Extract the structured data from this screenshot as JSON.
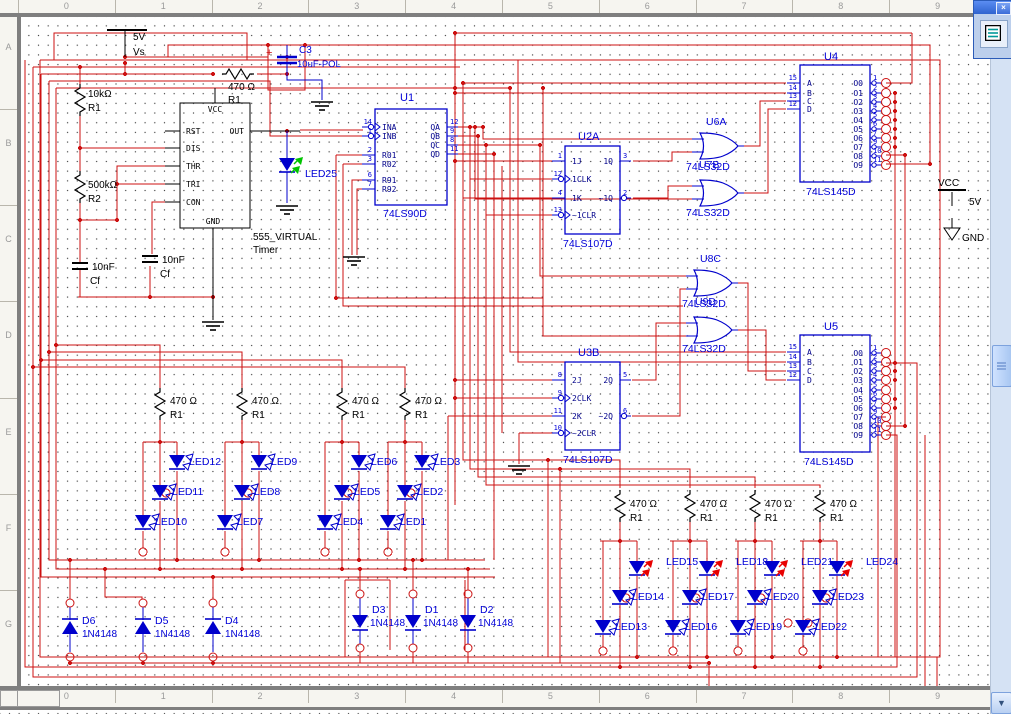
{
  "colors": {
    "wire_red": "#cc1111",
    "component_blue": "#0000cc",
    "label_blue": "#0000d8",
    "text_black": "#000000",
    "arrow_green": "#00c400",
    "arrow_red": "#e80000",
    "grid_dot": "#3f3f3f",
    "ruler_text": "#9a9a9a",
    "frame_gray": "#7f7f7f",
    "titlebar_blue": "#2f63cf",
    "scroll_track": "#d5e2f4"
  },
  "rulers": {
    "top": [
      "0",
      "1",
      "2",
      "3",
      "4",
      "5",
      "6",
      "7",
      "8",
      "9"
    ],
    "bottom": [
      "0",
      "1",
      "2",
      "3",
      "4",
      "5",
      "6",
      "7",
      "8",
      "9"
    ],
    "left": [
      "A",
      "B",
      "C",
      "D",
      "E",
      "F",
      "G"
    ]
  },
  "mini_window": {
    "close_label": "×"
  },
  "scrollbar": {
    "down_arrow": "▼"
  },
  "power": {
    "vcc_label": "VCC",
    "vcc_value": "5V",
    "gnd_label": "GND",
    "source_value": "5V",
    "source_ref": "Vs"
  },
  "timer555": {
    "part_line1": "555_VIRTUAL",
    "part_line2": "Timer",
    "pin_top": "VCC",
    "pin_bottom": "GND",
    "pin_right": "OUT",
    "pins_left": [
      "RST",
      "DIS",
      "THR",
      "TRI",
      "CON"
    ]
  },
  "ics": [
    {
      "ref": "U1",
      "part": "74LS90D",
      "left": [
        [
          "14",
          "INA"
        ],
        [
          "1",
          "INB"
        ],
        [
          "2",
          "R01"
        ],
        [
          "3",
          "R02"
        ],
        [
          "6",
          "R91"
        ],
        [
          "7",
          "R92"
        ]
      ],
      "right": [
        [
          "12",
          "QA"
        ],
        [
          "9",
          "QB"
        ],
        [
          "8",
          "QC"
        ],
        [
          "11",
          "QD"
        ]
      ]
    },
    {
      "ref": "U2A",
      "part": "74LS107D",
      "left": [
        [
          "1",
          "1J"
        ],
        [
          "12",
          "1CLK"
        ],
        [
          "4",
          "1K"
        ],
        [
          "13",
          "~1CLR"
        ]
      ],
      "right": [
        [
          "3",
          "1Q"
        ],
        [
          "2",
          "~1Q"
        ]
      ]
    },
    {
      "ref": "U3B",
      "part": "74LS107D",
      "left": [
        [
          "8",
          "2J"
        ],
        [
          "9",
          "2CLK"
        ],
        [
          "11",
          "2K"
        ],
        [
          "10",
          "~2CLR"
        ]
      ],
      "right": [
        [
          "5",
          "2Q"
        ],
        [
          "6",
          "~2Q"
        ]
      ]
    },
    {
      "ref": "U4",
      "part": "74LS145D",
      "left": [
        [
          "15",
          "A"
        ],
        [
          "14",
          "B"
        ],
        [
          "13",
          "C"
        ],
        [
          "12",
          "D"
        ]
      ],
      "right": [
        [
          "1",
          "O0"
        ],
        [
          "2",
          "O1"
        ],
        [
          "3",
          "O2"
        ],
        [
          "4",
          "O3"
        ],
        [
          "5",
          "O4"
        ],
        [
          "6",
          "O5"
        ],
        [
          "7",
          "O6"
        ],
        [
          "9",
          "O7"
        ],
        [
          "10",
          "O8"
        ],
        [
          "11",
          "O9"
        ]
      ]
    },
    {
      "ref": "U5",
      "part": "74LS145D",
      "left": [
        [
          "15",
          "A"
        ],
        [
          "14",
          "B"
        ],
        [
          "13",
          "C"
        ],
        [
          "12",
          "D"
        ]
      ],
      "right": [
        [
          "1",
          "O0"
        ],
        [
          "2",
          "O1"
        ],
        [
          "3",
          "O2"
        ],
        [
          "4",
          "O3"
        ],
        [
          "5",
          "O4"
        ],
        [
          "6",
          "O5"
        ],
        [
          "7",
          "O6"
        ],
        [
          "9",
          "O7"
        ],
        [
          "10",
          "O8"
        ],
        [
          "11",
          "O9"
        ]
      ]
    }
  ],
  "gates": [
    {
      "ref": "U6A",
      "part": "74LS32D"
    },
    {
      "ref": "U7B",
      "part": "74LS32D"
    },
    {
      "ref": "U8C",
      "part": "74LS32D"
    },
    {
      "ref": "U9D",
      "part": "74LS32D"
    }
  ],
  "resistors": [
    {
      "id": "r10k",
      "value": "10kΩ",
      "ref": "R1"
    },
    {
      "id": "r500k",
      "value": "500kΩ",
      "ref": "R2"
    },
    {
      "id": "r470top",
      "value": "470 Ω",
      "ref": "R1"
    },
    {
      "id": "rl0",
      "value": "470 Ω",
      "ref": "R1"
    },
    {
      "id": "rl1",
      "value": "470 Ω",
      "ref": "R1"
    },
    {
      "id": "rl2",
      "value": "470 Ω",
      "ref": "R1"
    },
    {
      "id": "rl3",
      "value": "470 Ω",
      "ref": "R1"
    },
    {
      "id": "rr0",
      "value": "470 Ω",
      "ref": "R1"
    },
    {
      "id": "rr1",
      "value": "470 Ω",
      "ref": "R1"
    },
    {
      "id": "rr2",
      "value": "470 Ω",
      "ref": "R1"
    },
    {
      "id": "rr3",
      "value": "470 Ω",
      "ref": "R1"
    }
  ],
  "capacitors": [
    {
      "id": "cf1",
      "value": "10nF",
      "ref": "Cf"
    },
    {
      "id": "cf2",
      "value": "10nF",
      "ref": "Cf"
    },
    {
      "id": "c3",
      "ref": "C3",
      "value": "10uF-POL",
      "polarity": "+"
    }
  ],
  "leds": {
    "indicator": {
      "label": "LED25"
    },
    "left_cluster": [
      "LED12",
      "LED11",
      "LED10",
      "LED9",
      "LED8",
      "LED7",
      "LED6",
      "LED5",
      "LED4",
      "LED3",
      "LED2",
      "LED1"
    ],
    "right_top": [
      "LED15",
      "LED18",
      "LED21",
      "LED24"
    ],
    "right_mid": [
      "LED14",
      "LED17",
      "LED20",
      "LED23"
    ],
    "right_bottom": [
      "LED13",
      "LED16",
      "LED19",
      "LED22"
    ]
  },
  "diodes": [
    {
      "ref": "D6",
      "part": "1N4148"
    },
    {
      "ref": "D5",
      "part": "1N4148"
    },
    {
      "ref": "D4",
      "part": "1N4148"
    },
    {
      "ref": "D3",
      "part": "1N4148"
    },
    {
      "ref": "D1",
      "part": "1N4148"
    },
    {
      "ref": "D2",
      "part": "1N4148"
    }
  ]
}
